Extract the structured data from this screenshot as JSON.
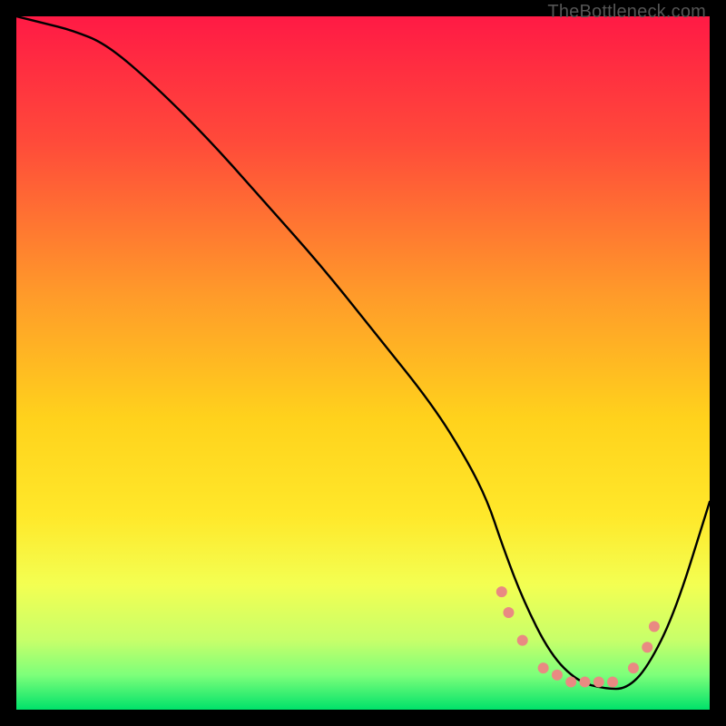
{
  "watermark": "TheBottleneck.com",
  "chart_data": {
    "type": "line",
    "title": "",
    "xlabel": "",
    "ylabel": "",
    "xlim": [
      0,
      100
    ],
    "ylim": [
      0,
      100
    ],
    "background_gradient": {
      "stops": [
        {
          "offset": 0,
          "color": "#ff1a45"
        },
        {
          "offset": 18,
          "color": "#ff4a3a"
        },
        {
          "offset": 40,
          "color": "#ff9a2a"
        },
        {
          "offset": 58,
          "color": "#ffd21c"
        },
        {
          "offset": 72,
          "color": "#ffe82a"
        },
        {
          "offset": 82,
          "color": "#f3ff52"
        },
        {
          "offset": 90,
          "color": "#c7ff6a"
        },
        {
          "offset": 95,
          "color": "#7dff7a"
        },
        {
          "offset": 100,
          "color": "#00e26a"
        }
      ]
    },
    "series": [
      {
        "name": "bottleneck-curve",
        "x": [
          0,
          4,
          8,
          13,
          20,
          28,
          36,
          44,
          52,
          60,
          65,
          68,
          70,
          73,
          77,
          81,
          85,
          88,
          91,
          95,
          100
        ],
        "values": [
          100,
          99,
          98,
          96,
          90,
          82,
          73,
          64,
          54,
          44,
          36,
          30,
          24,
          16,
          8,
          4,
          3,
          3,
          6,
          14,
          30
        ]
      }
    ],
    "markers": {
      "name": "highlighted-points",
      "color": "#e98a82",
      "points": [
        {
          "x": 70,
          "y": 17,
          "r": 6
        },
        {
          "x": 71,
          "y": 14,
          "r": 6
        },
        {
          "x": 73,
          "y": 10,
          "r": 6
        },
        {
          "x": 76,
          "y": 6,
          "r": 6
        },
        {
          "x": 78,
          "y": 5,
          "r": 6
        },
        {
          "x": 80,
          "y": 4,
          "r": 6
        },
        {
          "x": 82,
          "y": 4,
          "r": 6
        },
        {
          "x": 84,
          "y": 4,
          "r": 6
        },
        {
          "x": 86,
          "y": 4,
          "r": 6
        },
        {
          "x": 89,
          "y": 6,
          "r": 6
        },
        {
          "x": 91,
          "y": 9,
          "r": 6
        },
        {
          "x": 92,
          "y": 12,
          "r": 6
        }
      ]
    }
  }
}
